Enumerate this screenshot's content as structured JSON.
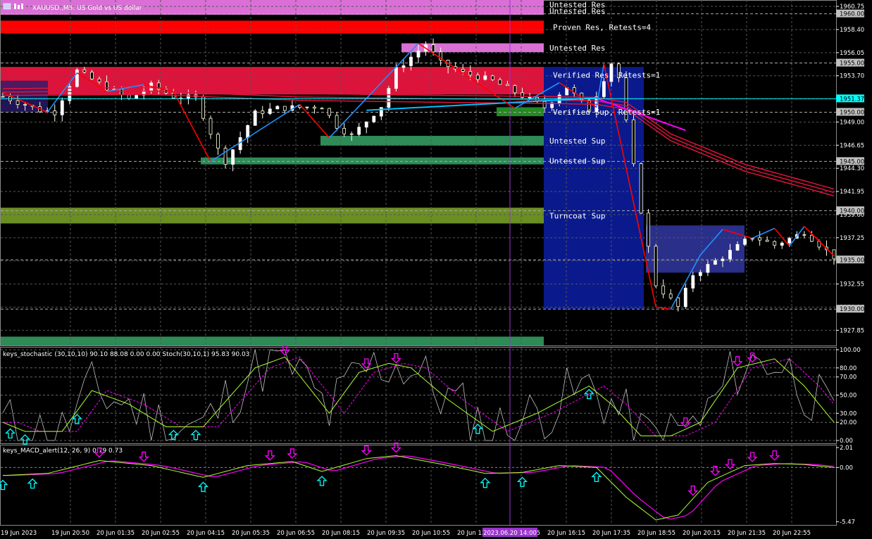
{
  "header": {
    "symbol": "XAUUSD.,M5:  US Gold vs US dollar"
  },
  "chart_data": [
    {
      "type": "candlestick",
      "title": "XAUUSD.,M5:  US Gold vs US dollar",
      "ylim": [
        1926.3,
        1961.4
      ],
      "y_ticks": [
        "1960.75",
        "1958.40",
        "1956.05",
        "1953.70",
        "1951.35",
        "1949.00",
        "1946.65",
        "1944.30",
        "1941.95",
        "1939.60",
        "1937.25",
        "1934.90",
        "1932.55",
        "1930.20",
        "1927.85"
      ],
      "price_boxes": [
        {
          "value": 1960.0,
          "label": "1960.00",
          "color": "#c0c0c0"
        },
        {
          "value": 1955.0,
          "label": "1955.00",
          "color": "#c0c0c0"
        },
        {
          "value": 1951.37,
          "label": "1951.37",
          "color": "#00ffff"
        },
        {
          "value": 1950.0,
          "label": "1950.00",
          "color": "#c0c0c0"
        },
        {
          "value": 1945.0,
          "label": "1945.00",
          "color": "#c0c0c0"
        },
        {
          "value": 1940.0,
          "label": "1940.00",
          "color": "#c0c0c0"
        },
        {
          "value": 1935.0,
          "label": "1935.00",
          "color": "#c0c0c0"
        },
        {
          "value": 1930.0,
          "label": "1930.00",
          "color": "#c0c0c0"
        }
      ],
      "zones": [
        {
          "label": "Untested Res",
          "y0": 1960.5,
          "y1": 1961.4,
          "color": "#da70d6"
        },
        {
          "label": "Untested Res",
          "y0": 1959.9,
          "y1": 1960.7,
          "color": "#da70d6"
        },
        {
          "label": "Proven Res, Retests=4",
          "y0": 1958.0,
          "y1": 1959.3,
          "color": "#ff0000"
        },
        {
          "label": "Untested Res",
          "y0": 1956.1,
          "y1": 1957.0,
          "color": "#da70d6"
        },
        {
          "label": "Verified Res, Retests=1",
          "y0": 1951.8,
          "y1": 1954.6,
          "color": "#dc143c"
        },
        {
          "label": "Verified Sup, Retests=1",
          "y0": 1949.6,
          "y1": 1950.5,
          "color": "#228b22"
        },
        {
          "label": "Untested Sup",
          "y0": 1946.6,
          "y1": 1947.6,
          "color": "#2e8b57"
        },
        {
          "label": "Untested Sup",
          "y0": 1944.7,
          "y1": 1945.4,
          "color": "#2e8b57"
        },
        {
          "label": "Turncoat Sup",
          "y0": 1938.7,
          "y1": 1940.3,
          "color": "#6b8e23"
        },
        {
          "label": "",
          "y0": 1926.3,
          "y1": 1927.2,
          "color": "#2e8b57"
        }
      ],
      "x_ticks": [
        "19 Jun 2023",
        "19 Jun 20:50",
        "20 Jun 01:35",
        "20 Jun 02:55",
        "20 Jun 04:15",
        "20 Jun 05:35",
        "20 Jun 06:55",
        "20 Jun 08:15",
        "20 Jun 09:35",
        "20 Jun 10:55",
        "20 Jun 12:",
        "20 Jun 14:55",
        "20 Jun 16:15",
        "20 Jun 17:35",
        "20 Jun 18:55",
        "20 Jun 20:15",
        "20 Jun 21:35",
        "20 Jun 22:55"
      ],
      "cursor_time": "2023.06.20 14:00"
    },
    {
      "type": "line",
      "title": "keys_stochastic (30,10,10) 90.10 88.08 0.00 0.00 Stoch(30,10,1) 95.83 90.03",
      "ylim": [
        0,
        100
      ],
      "y_ticks": [
        "100.00",
        "80.00",
        "70.00",
        "50.00",
        "30.00",
        "20.00",
        "0.00"
      ],
      "up_arrows": [
        1,
        3,
        10,
        23,
        26,
        64,
        79
      ],
      "down_arrows": [
        38,
        49,
        53,
        92,
        99,
        101
      ]
    },
    {
      "type": "line",
      "title": "keys_MACD_alert(12, 26, 9) 0.79 0.73",
      "ylim": [
        -5.8,
        2.3
      ],
      "y_ticks": [
        "2.01",
        "0.00",
        "-5.47"
      ],
      "up_arrows": [
        0,
        4,
        27,
        43,
        65,
        70,
        80
      ],
      "down_arrows": [
        13,
        19,
        36,
        39,
        49,
        53,
        93,
        96,
        98,
        101,
        104
      ]
    }
  ],
  "colors": {
    "background": "#000000",
    "bull_candle": "#ffffff",
    "bear_candle": "#ffffe0",
    "zigzag_up": "#1e90ff",
    "zigzag_down": "#ff0000",
    "ma_band": "#dc143c",
    "ma_fast": "#ff00ff",
    "ma_cyan": "#00bfff",
    "box_blue": "#0a1a8c",
    "box_mid": "#2a2f8a",
    "arrow_up": "#00ffff",
    "arrow_down": "#ff00ff",
    "stoch_main": "#adff2f",
    "stoch_signal": "#ff00ff",
    "stoch_fast": "#c0c0c0",
    "macd_main": "#adff2f",
    "macd_signal": "#ff00ff",
    "cursor": "#9932cc"
  }
}
